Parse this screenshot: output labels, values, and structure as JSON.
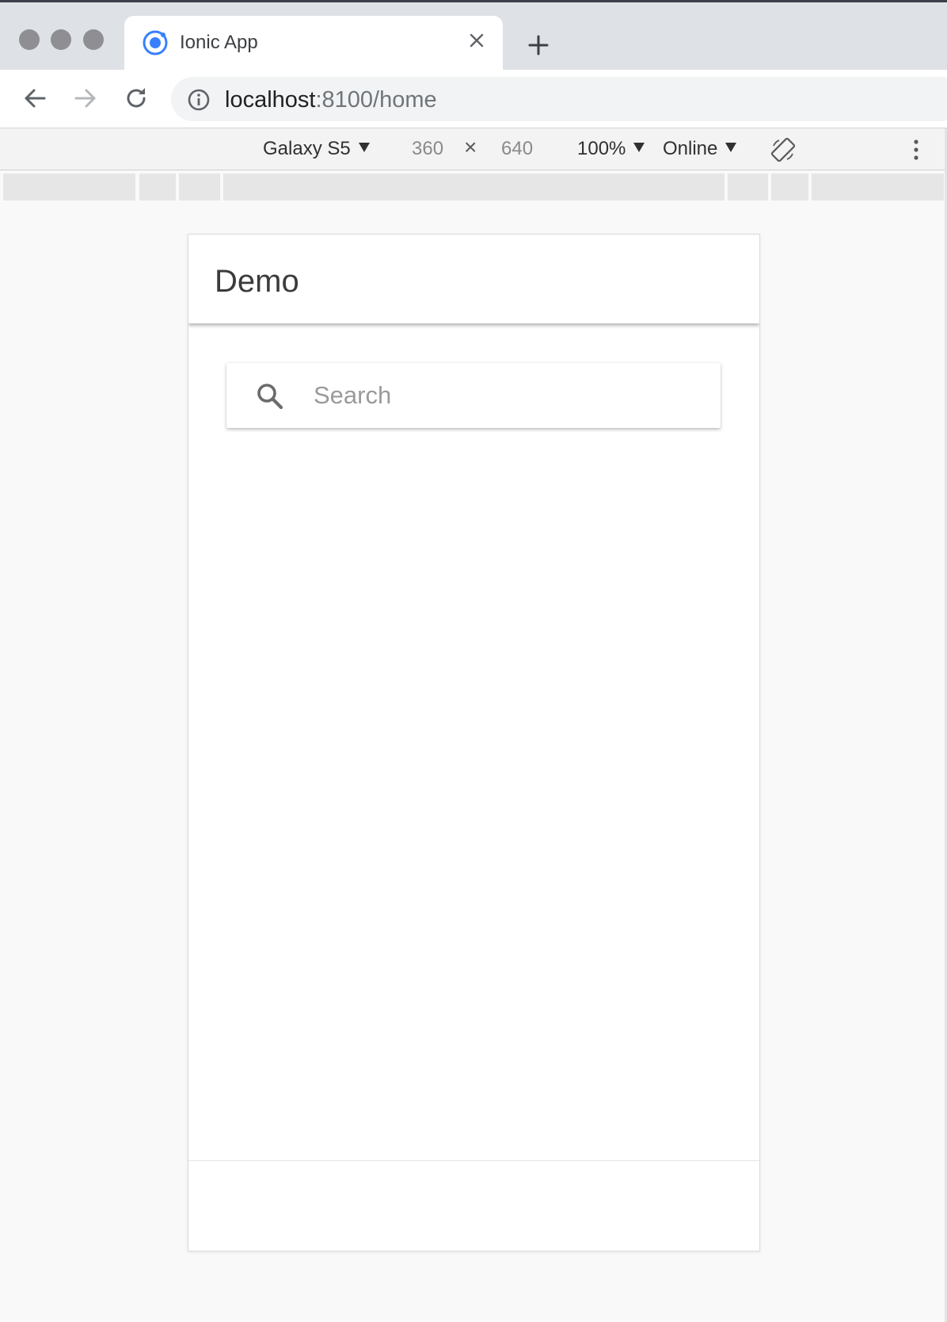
{
  "browser": {
    "tab": {
      "title": "Ionic App",
      "favicon": "ionic-logo-icon"
    },
    "url": {
      "host": "localhost",
      "path": ":8100/home"
    },
    "icons": {
      "back": "arrow-left-icon",
      "forward": "arrow-right-icon",
      "reload": "reload-icon",
      "info": "info-icon",
      "close_tab": "close-icon",
      "new_tab": "plus-icon"
    }
  },
  "device_toolbar": {
    "device": "Galaxy S5",
    "width": "360",
    "separator": "×",
    "height": "640",
    "zoom": "100%",
    "network": "Online"
  },
  "app": {
    "header_title": "Demo",
    "search": {
      "placeholder": "Search",
      "value": ""
    }
  },
  "colors": {
    "ionic_blue": "#3880ff",
    "page_bg": "#f9f9f9"
  }
}
